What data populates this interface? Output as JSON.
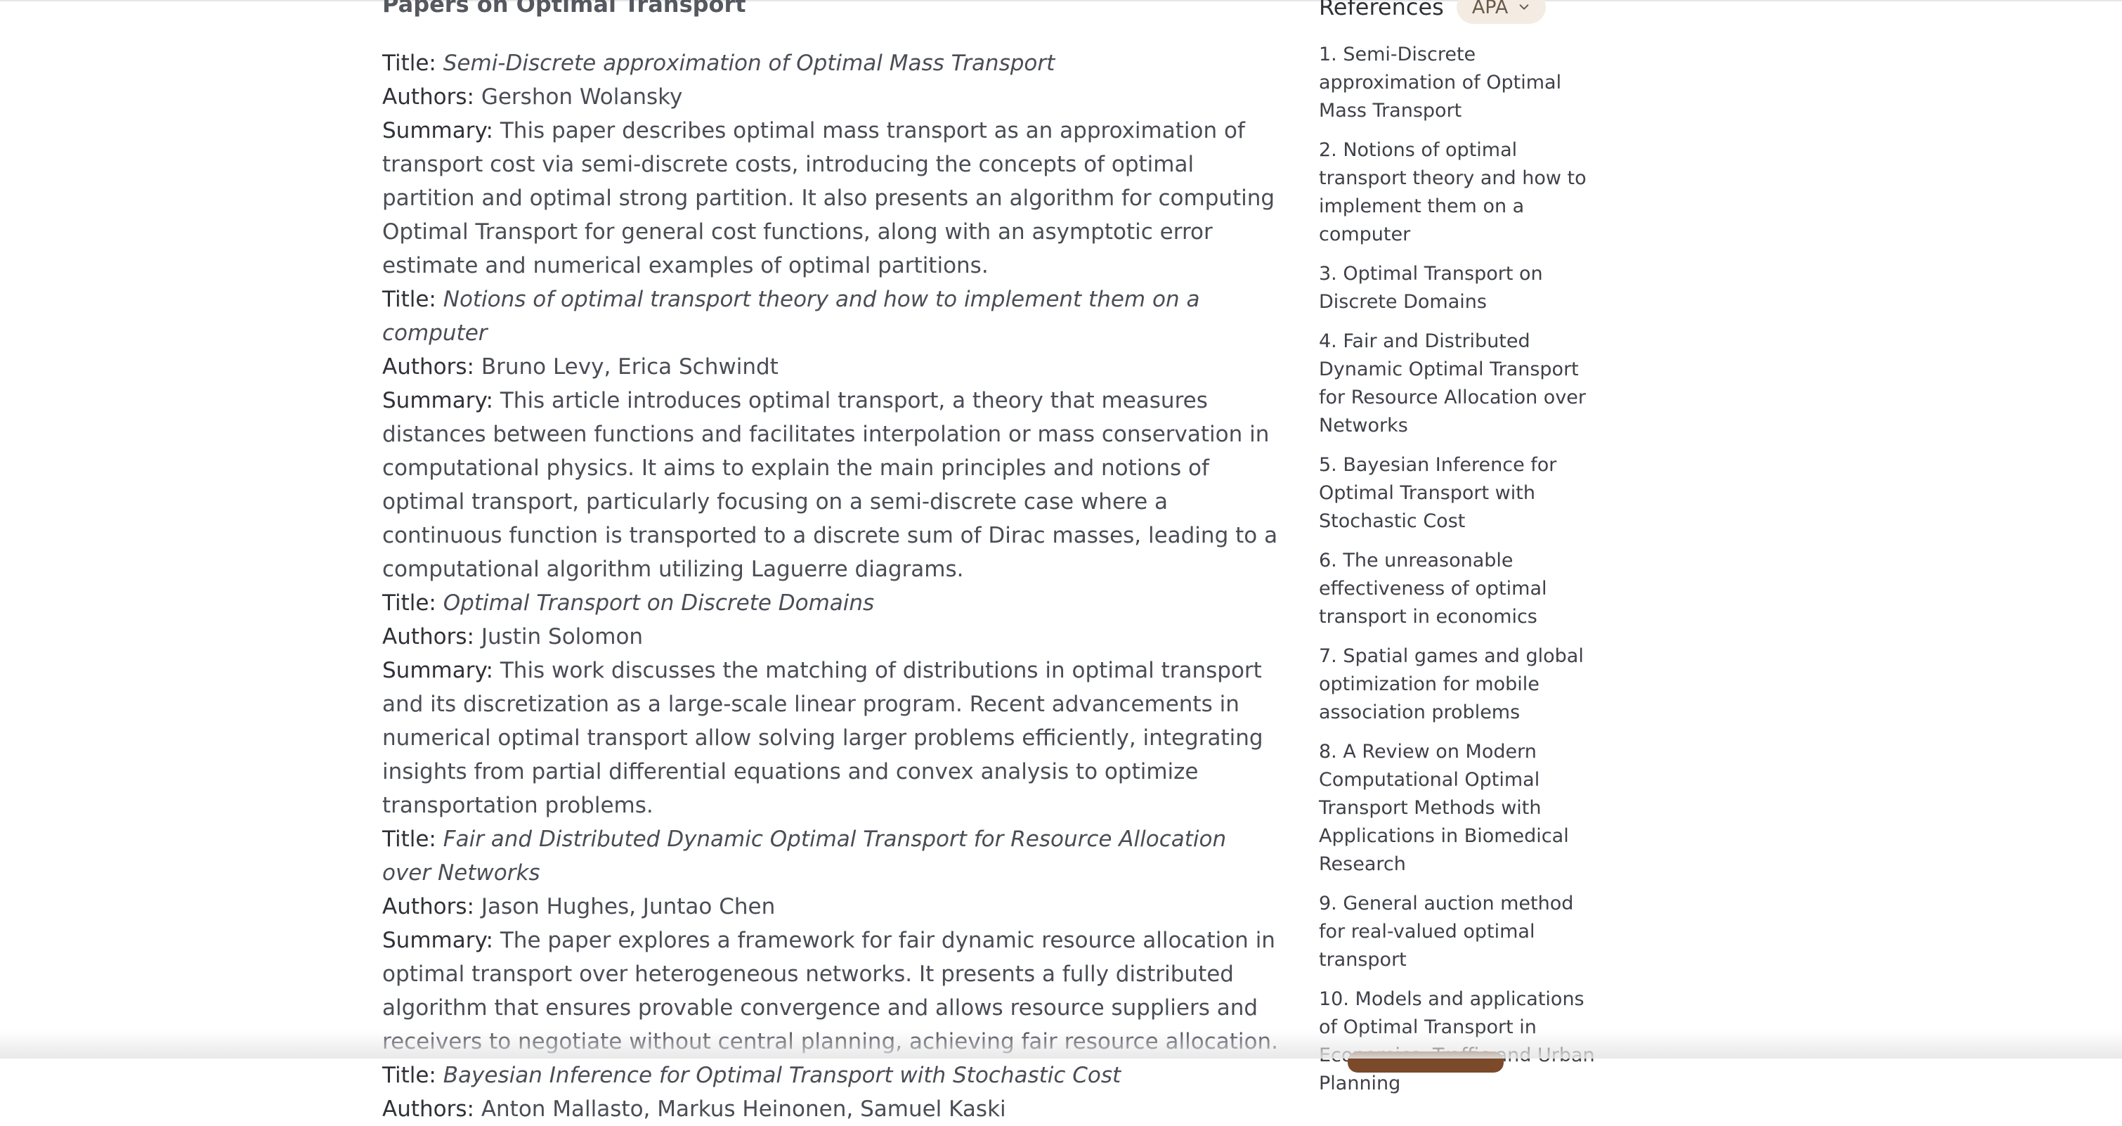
{
  "main": {
    "section_heading": "Papers on Optimal Transport",
    "labels": {
      "title": "Title:",
      "authors": "Authors:",
      "summary": "Summary:"
    },
    "papers": [
      {
        "title": "Semi-Discrete approximation of Optimal Mass Transport",
        "authors": "Gershon Wolansky",
        "summary": "This paper describes optimal mass transport as an approximation of transport cost via semi-discrete costs, introducing the concepts of optimal partition and optimal strong partition. It also presents an algorithm for computing Optimal Transport for general cost functions, along with an asymptotic error estimate and numerical examples of optimal partitions."
      },
      {
        "title": "Notions of optimal transport theory and how to implement them on a computer",
        "authors": "Bruno Levy, Erica Schwindt",
        "summary": "This article introduces optimal transport, a theory that measures distances between functions and facilitates interpolation or mass conservation in computational physics. It aims to explain the main principles and notions of optimal transport, particularly focusing on a semi-discrete case where a continuous function is transported to a discrete sum of Dirac masses, leading to a computational algorithm utilizing Laguerre diagrams."
      },
      {
        "title": "Optimal Transport on Discrete Domains",
        "authors": "Justin Solomon",
        "summary": "This work discusses the matching of distributions in optimal transport and its discretization as a large-scale linear program. Recent advancements in numerical optimal transport allow solving larger problems efficiently, integrating insights from partial differential equations and convex analysis to optimize transportation problems."
      },
      {
        "title": "Fair and Distributed Dynamic Optimal Transport for Resource Allocation over Networks",
        "authors": "Jason Hughes, Juntao Chen",
        "summary": "The paper explores a framework for fair dynamic resource allocation in optimal transport over heterogeneous networks. It presents a fully distributed algorithm that ensures provable convergence and allows resource suppliers and receivers to negotiate without central planning, achieving fair resource allocation."
      },
      {
        "title": "Bayesian Inference for Optimal Transport with Stochastic Cost",
        "authors": "Anton Mallasto, Markus Heinonen, Samuel Kaski"
      }
    ]
  },
  "references": {
    "title": "References",
    "style_selected": "APA",
    "chevron_icon": "chevron-down-icon",
    "items": [
      "1. Semi-Discrete approximation of Optimal Mass Transport",
      "2. Notions of optimal transport theory and how to implement them on a computer",
      "3. Optimal Transport on Discrete Domains",
      "4. Fair and Distributed Dynamic Optimal Transport for Resource Allocation over Networks",
      "5. Bayesian Inference for Optimal Transport with Stochastic Cost",
      "6. The unreasonable effectiveness of optimal transport in economics",
      "7. Spatial games and global optimization for mobile association problems",
      "8. A Review on Modern Computational Optimal Transport Methods with Applications in Biomedical Research",
      "9. General auction method for real-valued optimal transport",
      "10. Models and applications of Optimal Transport in Economics, Traffic and Urban Planning"
    ]
  }
}
